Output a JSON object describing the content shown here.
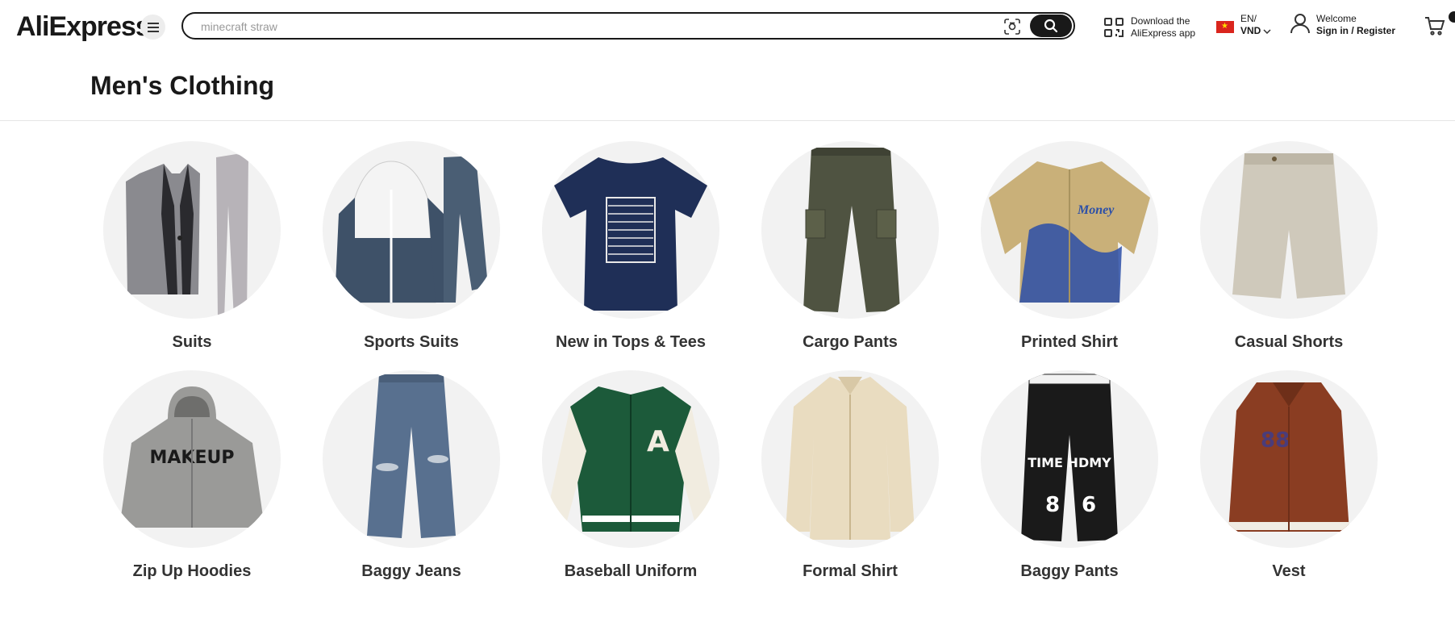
{
  "header": {
    "logo_text": "AliExpress",
    "search_placeholder": "minecraft straw",
    "app_download_line1": "Download the",
    "app_download_line2": "AliExpress app",
    "lang_line1": "EN/",
    "lang_line2": "VND",
    "welcome_line1": "Welcome",
    "welcome_line2": "Sign in / Register"
  },
  "page": {
    "title": "Men's Clothing"
  },
  "categories": [
    {
      "label": "Suits",
      "icon": "suit-icon"
    },
    {
      "label": "Sports Suits",
      "icon": "tracksuit-icon"
    },
    {
      "label": "New in Tops & Tees",
      "icon": "tshirt-icon"
    },
    {
      "label": "Cargo Pants",
      "icon": "cargo-pants-icon"
    },
    {
      "label": "Printed Shirt",
      "icon": "printed-shirt-icon"
    },
    {
      "label": "Casual Shorts",
      "icon": "shorts-icon"
    },
    {
      "label": "Zip Up Hoodies",
      "icon": "hoodie-icon"
    },
    {
      "label": "Baggy Jeans",
      "icon": "jeans-icon"
    },
    {
      "label": "Baseball Uniform",
      "icon": "varsity-jacket-icon"
    },
    {
      "label": "Formal Shirt",
      "icon": "formal-shirt-icon"
    },
    {
      "label": "Baggy Pants",
      "icon": "baggy-pants-icon"
    },
    {
      "label": "Vest",
      "icon": "vest-icon"
    }
  ]
}
